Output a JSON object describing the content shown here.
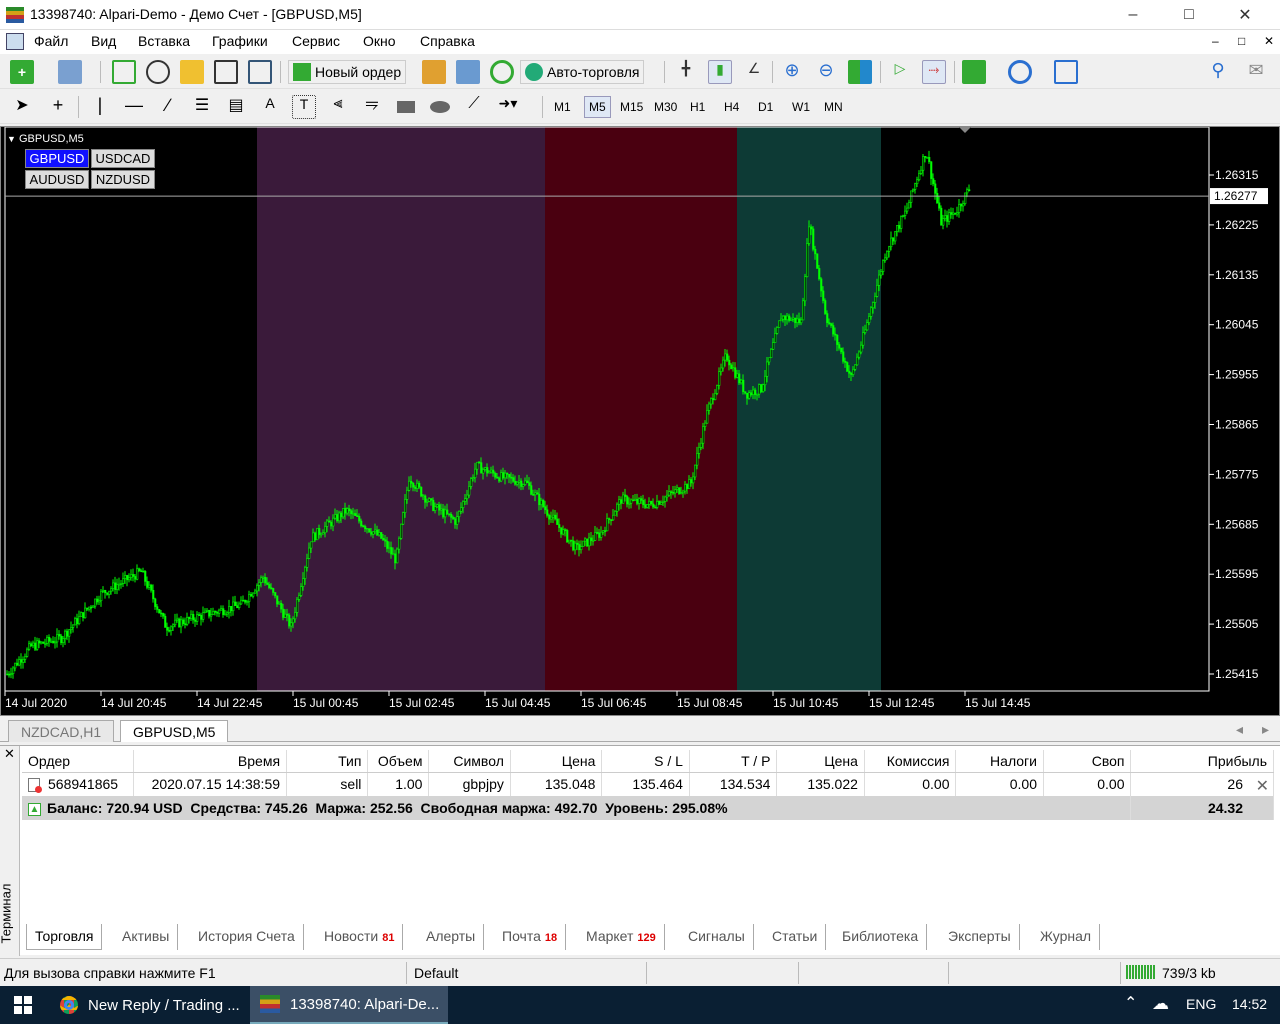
{
  "window": {
    "title": "13398740: Alpari-Demo - Демо Счет - [GBPUSD,M5]"
  },
  "menu": [
    "Файл",
    "Вид",
    "Вставка",
    "Графики",
    "Сервис",
    "Окно",
    "Справка"
  ],
  "toolbar": {
    "new_order": "Новый ордер",
    "autotrading": "Авто-торговля"
  },
  "timeframes": [
    "M1",
    "M5",
    "M15",
    "M30",
    "H1",
    "H4",
    "D1",
    "W1",
    "MN"
  ],
  "selected_timeframe": "M5",
  "chart": {
    "label": "GBPUSD,M5",
    "symbol_buttons": [
      "GBPUSD",
      "USDCAD",
      "AUDUSD",
      "NZDUSD"
    ],
    "active_symbol": "GBPUSD",
    "current_price": "1.26277",
    "price_ticks": [
      "1.26315",
      "1.26225",
      "1.26135",
      "1.26045",
      "1.25955",
      "1.25865",
      "1.25775",
      "1.25685",
      "1.25595",
      "1.25505",
      "1.25415"
    ],
    "time_ticks": [
      "14 Jul 2020",
      "14 Jul 20:45",
      "14 Jul 22:45",
      "15 Jul 00:45",
      "15 Jul 02:45",
      "15 Jul 04:45",
      "15 Jul 06:45",
      "15 Jul 08:45",
      "15 Jul 10:45",
      "15 Jul 12:45",
      "15 Jul 14:45"
    ],
    "session_colors": [
      "#3a1a3a",
      "#4a0010",
      "#0d3a35"
    ],
    "candle_color": "#00ff00"
  },
  "chart_tabs": [
    "NZDCAD,H1",
    "GBPUSD,M5"
  ],
  "active_chart_tab": "GBPUSD,M5",
  "terminal": {
    "side_label": "Терминал",
    "columns": [
      "Ордер",
      "Время",
      "Тип",
      "Объем",
      "Символ",
      "Цена",
      "S / L",
      "T / P",
      "Цена",
      "Комиссия",
      "Налоги",
      "Своп",
      "Прибыль"
    ],
    "order": {
      "id": "568941865",
      "time": "2020.07.15 14:38:59",
      "type": "sell",
      "volume": "1.00",
      "symbol": "gbpjpy",
      "price": "135.048",
      "sl": "135.464",
      "tp": "134.534",
      "current": "135.022",
      "commission": "0.00",
      "taxes": "0.00",
      "swap": "0.00",
      "profit": "26"
    },
    "balance_line": "Баланс: 720.94 USD  Средства: 745.26  Маржа: 252.56  Свободная маржа: 492.70  Уровень: 295.08%",
    "balance_profit": "24.32",
    "tabs": [
      {
        "label": "Торговля",
        "badge": ""
      },
      {
        "label": "Активы",
        "badge": ""
      },
      {
        "label": "История Счета",
        "badge": ""
      },
      {
        "label": "Новости",
        "badge": "81"
      },
      {
        "label": "Алерты",
        "badge": ""
      },
      {
        "label": "Почта",
        "badge": "18"
      },
      {
        "label": "Маркет",
        "badge": "129"
      },
      {
        "label": "Сигналы",
        "badge": ""
      },
      {
        "label": "Статьи",
        "badge": ""
      },
      {
        "label": "Библиотека",
        "badge": ""
      },
      {
        "label": "Эксперты",
        "badge": ""
      },
      {
        "label": "Журнал",
        "badge": ""
      }
    ],
    "active_tab": "Торговля"
  },
  "status": {
    "help": "Для вызова справки нажмите F1",
    "profile": "Default",
    "traffic": "739/3 kb"
  },
  "taskbar": {
    "item1": "New Reply / Trading ...",
    "item2": "13398740: Alpari-De...",
    "lang": "ENG",
    "time": "14:52"
  }
}
